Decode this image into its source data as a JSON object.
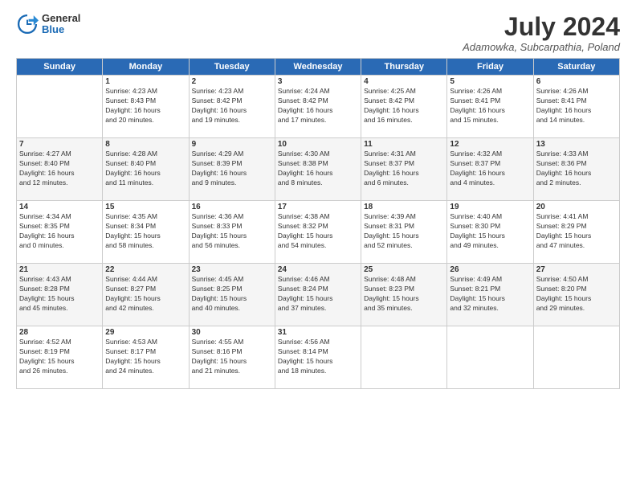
{
  "header": {
    "logo_general": "General",
    "logo_blue": "Blue",
    "title": "July 2024",
    "location": "Adamowka, Subcarpathia, Poland"
  },
  "days_of_week": [
    "Sunday",
    "Monday",
    "Tuesday",
    "Wednesday",
    "Thursday",
    "Friday",
    "Saturday"
  ],
  "weeks": [
    [
      {
        "day": "",
        "content": ""
      },
      {
        "day": "1",
        "content": "Sunrise: 4:23 AM\nSunset: 8:43 PM\nDaylight: 16 hours\nand 20 minutes."
      },
      {
        "day": "2",
        "content": "Sunrise: 4:23 AM\nSunset: 8:42 PM\nDaylight: 16 hours\nand 19 minutes."
      },
      {
        "day": "3",
        "content": "Sunrise: 4:24 AM\nSunset: 8:42 PM\nDaylight: 16 hours\nand 17 minutes."
      },
      {
        "day": "4",
        "content": "Sunrise: 4:25 AM\nSunset: 8:42 PM\nDaylight: 16 hours\nand 16 minutes."
      },
      {
        "day": "5",
        "content": "Sunrise: 4:26 AM\nSunset: 8:41 PM\nDaylight: 16 hours\nand 15 minutes."
      },
      {
        "day": "6",
        "content": "Sunrise: 4:26 AM\nSunset: 8:41 PM\nDaylight: 16 hours\nand 14 minutes."
      }
    ],
    [
      {
        "day": "7",
        "content": "Sunrise: 4:27 AM\nSunset: 8:40 PM\nDaylight: 16 hours\nand 12 minutes."
      },
      {
        "day": "8",
        "content": "Sunrise: 4:28 AM\nSunset: 8:40 PM\nDaylight: 16 hours\nand 11 minutes."
      },
      {
        "day": "9",
        "content": "Sunrise: 4:29 AM\nSunset: 8:39 PM\nDaylight: 16 hours\nand 9 minutes."
      },
      {
        "day": "10",
        "content": "Sunrise: 4:30 AM\nSunset: 8:38 PM\nDaylight: 16 hours\nand 8 minutes."
      },
      {
        "day": "11",
        "content": "Sunrise: 4:31 AM\nSunset: 8:37 PM\nDaylight: 16 hours\nand 6 minutes."
      },
      {
        "day": "12",
        "content": "Sunrise: 4:32 AM\nSunset: 8:37 PM\nDaylight: 16 hours\nand 4 minutes."
      },
      {
        "day": "13",
        "content": "Sunrise: 4:33 AM\nSunset: 8:36 PM\nDaylight: 16 hours\nand 2 minutes."
      }
    ],
    [
      {
        "day": "14",
        "content": "Sunrise: 4:34 AM\nSunset: 8:35 PM\nDaylight: 16 hours\nand 0 minutes."
      },
      {
        "day": "15",
        "content": "Sunrise: 4:35 AM\nSunset: 8:34 PM\nDaylight: 15 hours\nand 58 minutes."
      },
      {
        "day": "16",
        "content": "Sunrise: 4:36 AM\nSunset: 8:33 PM\nDaylight: 15 hours\nand 56 minutes."
      },
      {
        "day": "17",
        "content": "Sunrise: 4:38 AM\nSunset: 8:32 PM\nDaylight: 15 hours\nand 54 minutes."
      },
      {
        "day": "18",
        "content": "Sunrise: 4:39 AM\nSunset: 8:31 PM\nDaylight: 15 hours\nand 52 minutes."
      },
      {
        "day": "19",
        "content": "Sunrise: 4:40 AM\nSunset: 8:30 PM\nDaylight: 15 hours\nand 49 minutes."
      },
      {
        "day": "20",
        "content": "Sunrise: 4:41 AM\nSunset: 8:29 PM\nDaylight: 15 hours\nand 47 minutes."
      }
    ],
    [
      {
        "day": "21",
        "content": "Sunrise: 4:43 AM\nSunset: 8:28 PM\nDaylight: 15 hours\nand 45 minutes."
      },
      {
        "day": "22",
        "content": "Sunrise: 4:44 AM\nSunset: 8:27 PM\nDaylight: 15 hours\nand 42 minutes."
      },
      {
        "day": "23",
        "content": "Sunrise: 4:45 AM\nSunset: 8:25 PM\nDaylight: 15 hours\nand 40 minutes."
      },
      {
        "day": "24",
        "content": "Sunrise: 4:46 AM\nSunset: 8:24 PM\nDaylight: 15 hours\nand 37 minutes."
      },
      {
        "day": "25",
        "content": "Sunrise: 4:48 AM\nSunset: 8:23 PM\nDaylight: 15 hours\nand 35 minutes."
      },
      {
        "day": "26",
        "content": "Sunrise: 4:49 AM\nSunset: 8:21 PM\nDaylight: 15 hours\nand 32 minutes."
      },
      {
        "day": "27",
        "content": "Sunrise: 4:50 AM\nSunset: 8:20 PM\nDaylight: 15 hours\nand 29 minutes."
      }
    ],
    [
      {
        "day": "28",
        "content": "Sunrise: 4:52 AM\nSunset: 8:19 PM\nDaylight: 15 hours\nand 26 minutes."
      },
      {
        "day": "29",
        "content": "Sunrise: 4:53 AM\nSunset: 8:17 PM\nDaylight: 15 hours\nand 24 minutes."
      },
      {
        "day": "30",
        "content": "Sunrise: 4:55 AM\nSunset: 8:16 PM\nDaylight: 15 hours\nand 21 minutes."
      },
      {
        "day": "31",
        "content": "Sunrise: 4:56 AM\nSunset: 8:14 PM\nDaylight: 15 hours\nand 18 minutes."
      },
      {
        "day": "",
        "content": ""
      },
      {
        "day": "",
        "content": ""
      },
      {
        "day": "",
        "content": ""
      }
    ]
  ]
}
